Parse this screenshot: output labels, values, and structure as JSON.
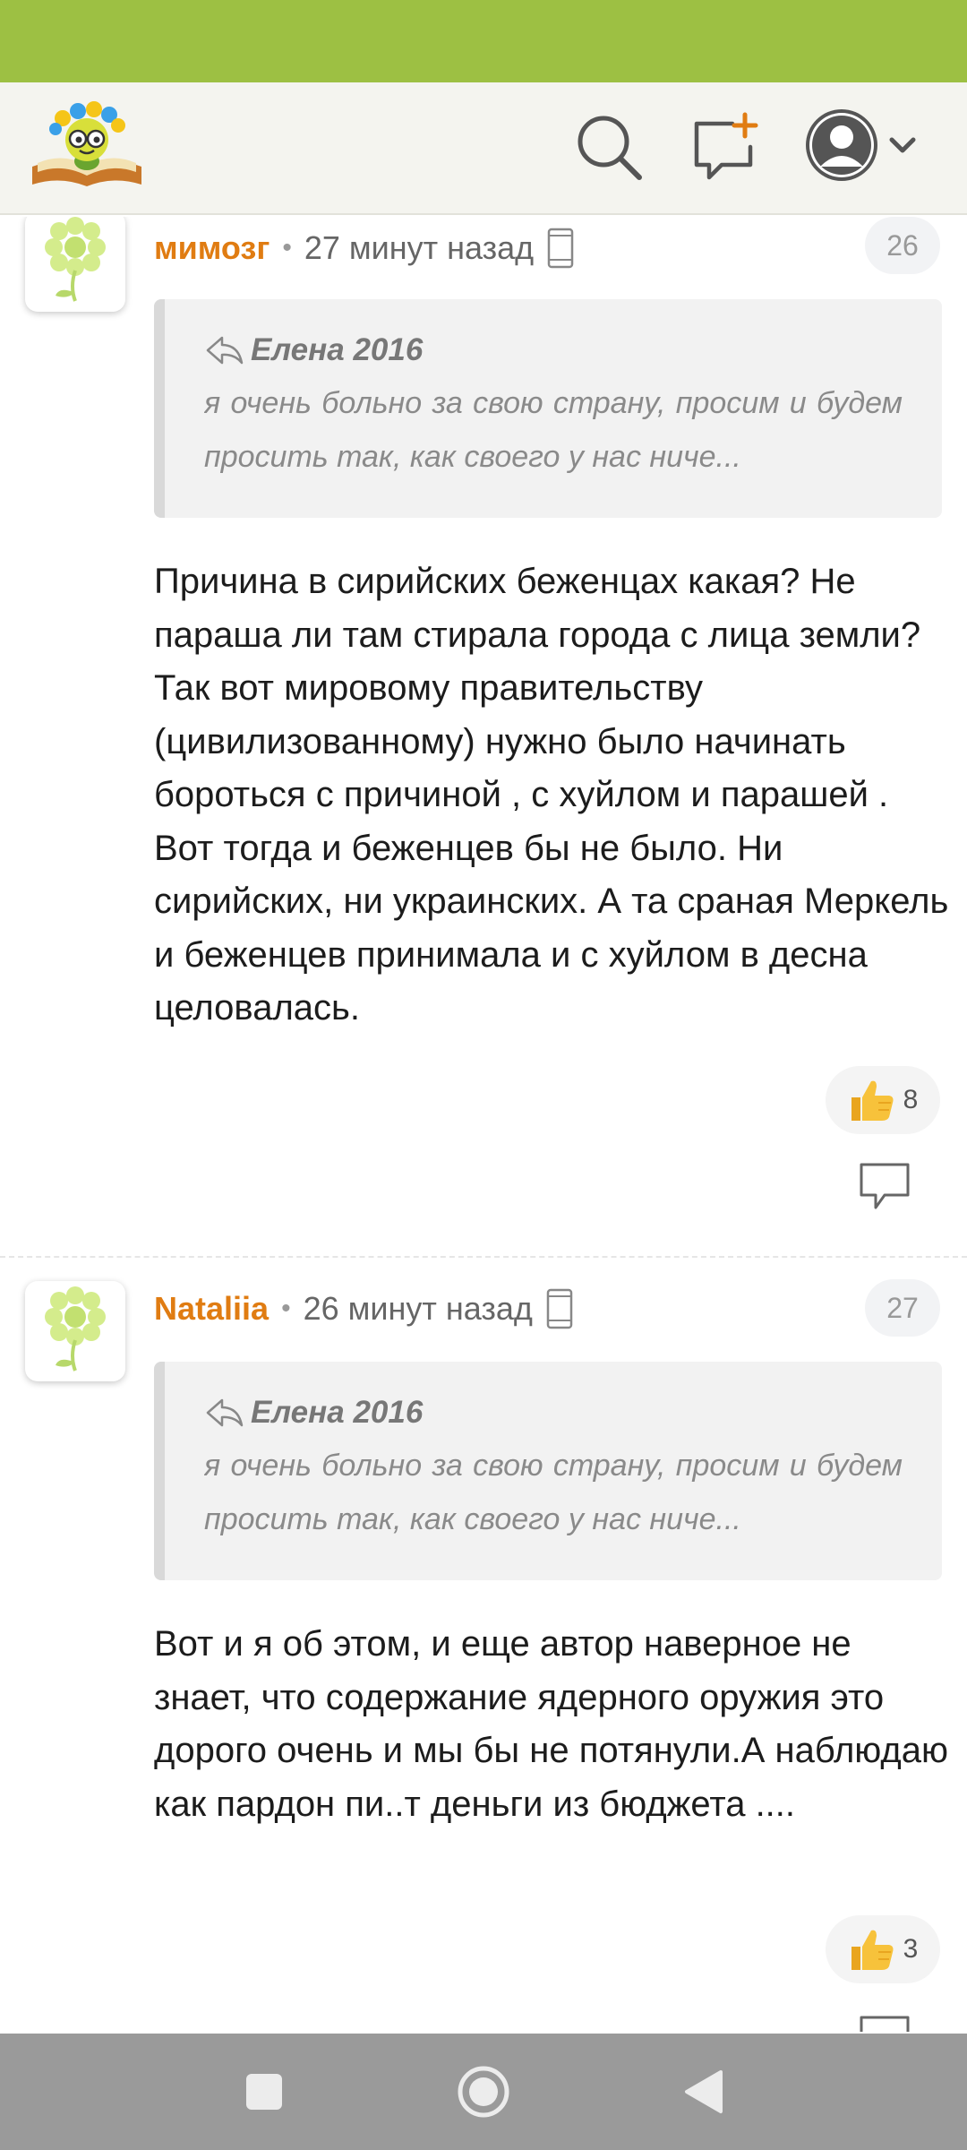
{
  "appbar": {
    "logo_icon": "bookworm-logo-icon",
    "search_icon": "search-icon",
    "add_comment_icon": "add-comment-icon",
    "profile_icon": "user-avatar-icon",
    "accent": "#e07c12"
  },
  "comments": [
    {
      "author": "мимозг",
      "time": "27 минут назад",
      "number": "26",
      "quote_author": "Елена 2016",
      "quote_text": "я очень больно за свою страну, просим и будем просить так, как своего у нас ниче...",
      "text": "Причина в сирийских беженцах какая? Не параша ли там стирала города с лица земли? Так вот мировому правительству (цивилизованному) нужно было начинать бороться с причиной , с хуйлом и парашей . Вот тогда и беженцев бы не было. Ни сирийских, ни украинских. А та сраная Меркель и беженцев принимала и с хуйлом в десна целовалась.",
      "likes": "8"
    },
    {
      "author": "Nataliia",
      "time": "26 минут назад",
      "number": "27",
      "quote_author": "Елена 2016",
      "quote_text": "я очень больно за свою страну, просим и будем просить так, как своего у нас ниче...",
      "text": "Вот и я об этом, и еще автор наверное не знает, что содержание ядерного оружия это дорого очень и мы бы не потянули.А наблюдаю как пардон пи..т деньги из бюджета ....",
      "likes": "3"
    }
  ],
  "navbar": {
    "recents_icon": "square-icon",
    "home_icon": "circle-icon",
    "back_icon": "triangle-back-icon"
  }
}
